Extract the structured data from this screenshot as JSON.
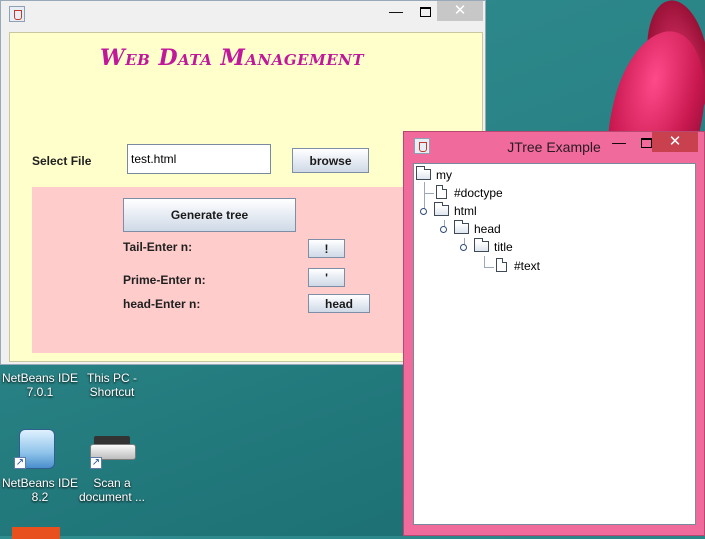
{
  "main_window": {
    "title": "Web Data Management",
    "select_file_label": "Select File",
    "file_value": "test.html",
    "browse_label": "browse",
    "generate_label": "Generate tree",
    "tail_label": "Tail-Enter n:",
    "tail_button": "!",
    "prime_label": "Prime-Enter n:",
    "prime_button": "'",
    "head_label": "head-Enter n:",
    "head_button": "head",
    "controls": {
      "minimize": "—",
      "close": "✕"
    }
  },
  "tree_window": {
    "title": "JTree Example",
    "controls": {
      "minimize": "—",
      "close": "✕"
    },
    "nodes": [
      "my",
      "#doctype",
      "html",
      "head",
      "title",
      "#text"
    ]
  },
  "desktop": {
    "icons": [
      {
        "label": "NetBeans IDE 7.0.1"
      },
      {
        "label": "This PC - Shortcut"
      },
      {
        "label": "NetBeans IDE 8.2"
      },
      {
        "label": "Scan a document ..."
      }
    ]
  },
  "colors": {
    "title_magenta": "#c0189a",
    "client_yellow": "#ffffcc",
    "panel_pink": "#ffcccc",
    "tree_window_pink": "#f06a9b"
  }
}
